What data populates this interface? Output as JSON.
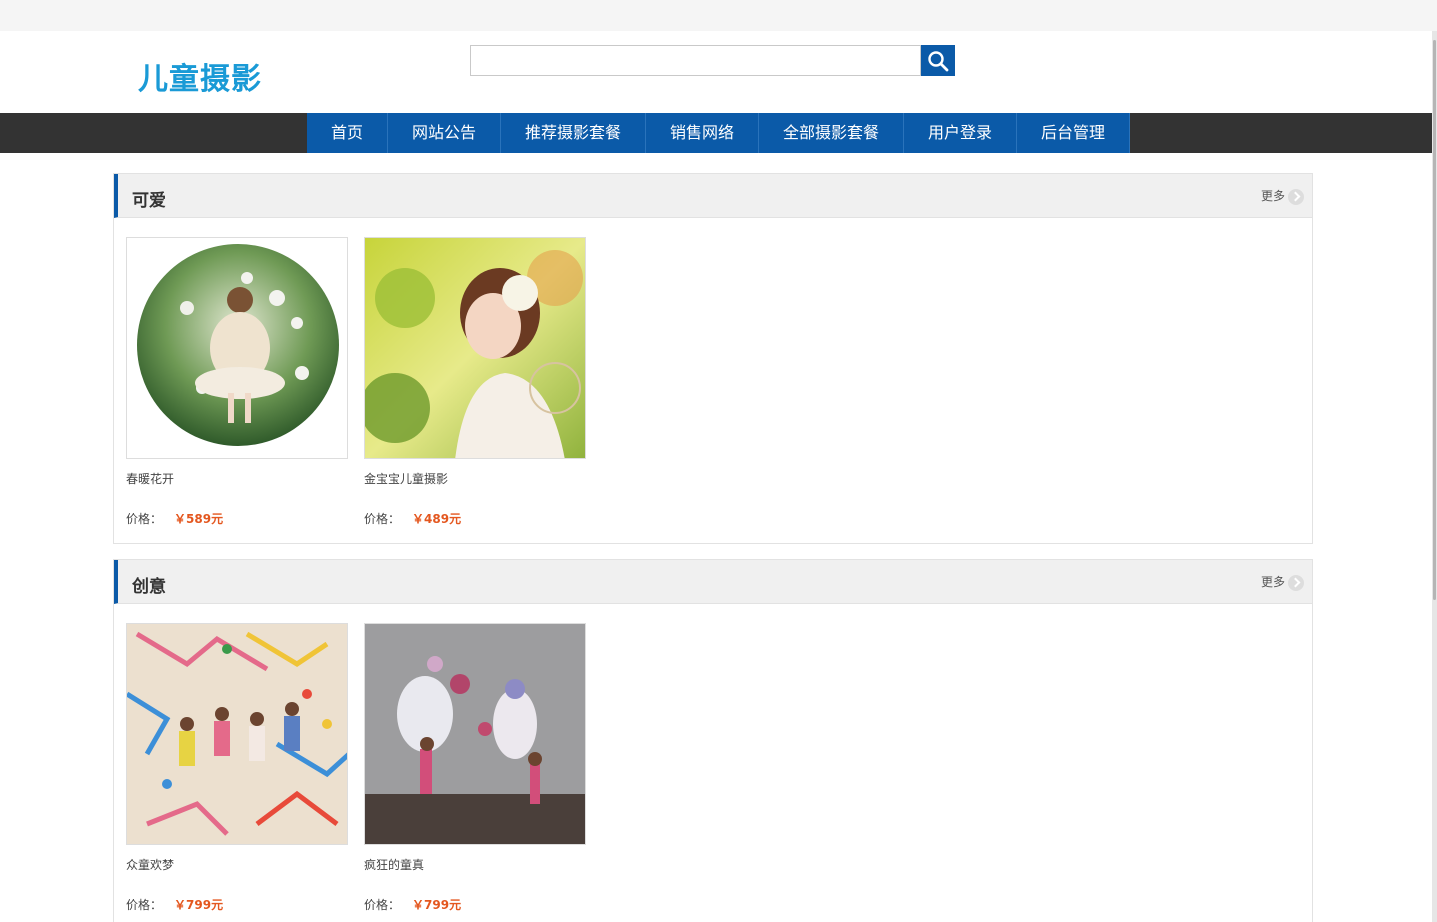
{
  "header": {
    "logo": "儿童摄影",
    "search": {
      "value": "",
      "placeholder": ""
    }
  },
  "nav": {
    "items": [
      "首页",
      "网站公告",
      "推荐摄影套餐",
      "销售网络",
      "全部摄影套餐",
      "用户登录",
      "后台管理"
    ]
  },
  "sections": [
    {
      "title": "可爱",
      "more": "更多",
      "products": [
        {
          "name": "春暖花开",
          "price_label": "价格：",
          "price": "￥589元"
        },
        {
          "name": "金宝宝儿童摄影",
          "price_label": "价格：",
          "price": "￥489元"
        }
      ]
    },
    {
      "title": "创意",
      "more": "更多",
      "products": [
        {
          "name": "众童欢梦",
          "price_label": "价格：",
          "price": "￥799元"
        },
        {
          "name": "疯狂的童真",
          "price_label": "价格：",
          "price": "￥799元"
        }
      ]
    }
  ],
  "colors": {
    "brand_blue": "#0b5aa8",
    "logo_blue": "#1a9ad6",
    "price_orange": "#e4571f",
    "nav_dark": "#333333"
  },
  "icons": {
    "search": "search-icon",
    "more": "chevron-right-icon"
  }
}
